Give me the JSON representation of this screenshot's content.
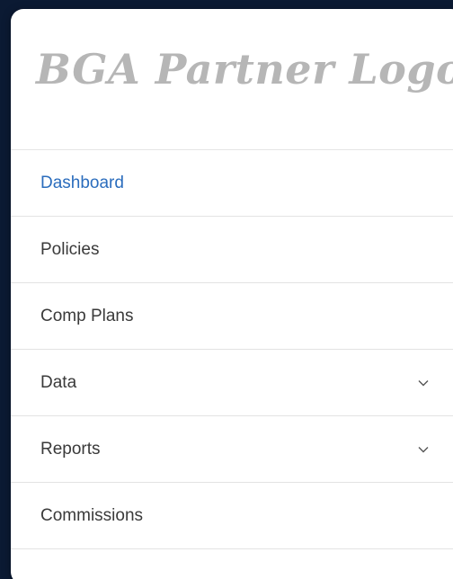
{
  "logo": {
    "text": "BGA Partner Logo"
  },
  "nav": {
    "items": [
      {
        "label": "Dashboard",
        "active": true,
        "has_submenu": false
      },
      {
        "label": "Policies",
        "active": false,
        "has_submenu": false
      },
      {
        "label": "Comp Plans",
        "active": false,
        "has_submenu": false
      },
      {
        "label": "Data",
        "active": false,
        "has_submenu": true
      },
      {
        "label": "Reports",
        "active": false,
        "has_submenu": true
      },
      {
        "label": "Commissions",
        "active": false,
        "has_submenu": false
      }
    ]
  },
  "colors": {
    "background": "#0b1a33",
    "active": "#2b6dbd",
    "logo": "#b6b6b6"
  },
  "icons": {
    "submenu": "chevron-down-icon"
  }
}
